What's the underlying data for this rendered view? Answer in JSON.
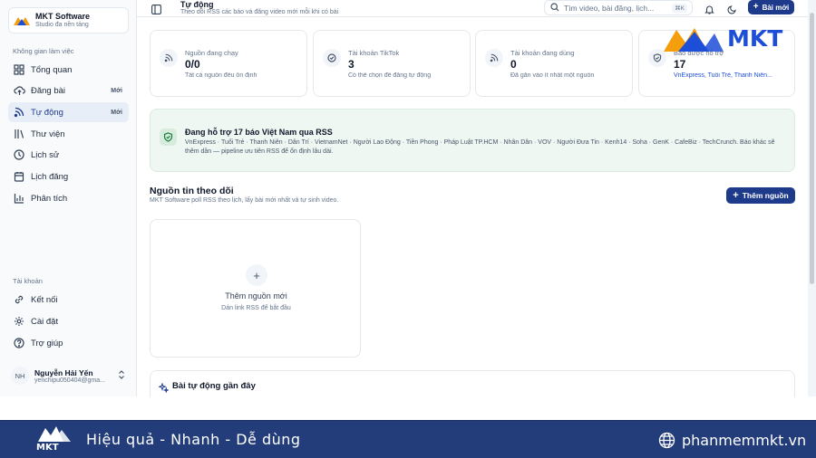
{
  "brand": {
    "name": "MKT Software",
    "subtitle": "Studio đa nền tảng"
  },
  "sidebar": {
    "workspace_label": "Không gian làm việc",
    "items": [
      {
        "label": "Tổng quan",
        "icon": "grid-icon",
        "badge": ""
      },
      {
        "label": "Đăng bài",
        "icon": "cloud-upload-icon",
        "badge": "Mới"
      },
      {
        "label": "Tự động",
        "icon": "rss-icon",
        "badge": "Mới",
        "active": true
      },
      {
        "label": "Thư viện",
        "icon": "library-icon",
        "badge": ""
      },
      {
        "label": "Lịch sử",
        "icon": "clock-icon",
        "badge": ""
      },
      {
        "label": "Lịch đăng",
        "icon": "calendar-icon",
        "badge": ""
      },
      {
        "label": "Phân tích",
        "icon": "bar-chart-icon",
        "badge": ""
      }
    ],
    "account_label": "Tài khoản",
    "account_items": [
      {
        "label": "Kết nối",
        "icon": "link-icon"
      },
      {
        "label": "Cài đặt",
        "icon": "gear-icon"
      },
      {
        "label": "Trợ giúp",
        "icon": "help-icon"
      }
    ],
    "user": {
      "initials": "NH",
      "name": "Nguyễn Hải Yến",
      "email": "yenchipu050404@gma..."
    }
  },
  "header": {
    "title": "Tự động",
    "subtitle": "Theo dõi RSS các báo và đăng video mới mỗi khi có bài",
    "search_placeholder": "Tìm video, bài đăng, lịch...",
    "search_shortcut": "⌘K",
    "new_post_label": "Bài mới"
  },
  "stats": [
    {
      "label": "Nguồn đang chạy",
      "value": "0/0",
      "desc": "Tất cả nguồn đều ổn định",
      "icon": "rss-icon"
    },
    {
      "label": "Tài khoản TikTok",
      "value": "3",
      "desc": "Có thể chọn để đăng tự động",
      "icon": "check-circle-icon"
    },
    {
      "label": "Tài khoản đang dùng",
      "value": "0",
      "desc": "Đã gắn vào ít nhất một nguồn",
      "icon": "rss-icon"
    },
    {
      "label": "Báo được hỗ trợ",
      "value": "17",
      "desc": "VnExpress, Tuổi Trẻ, Thanh Niên...",
      "icon": "shield-check-icon"
    }
  ],
  "rss_info": {
    "title": "Đang hỗ trợ 17 báo Việt Nam qua RSS",
    "text": "VnExpress · Tuổi Trẻ · Thanh Niên · Dân Trí · VietnamNet · Người Lao Động · Tiền Phong · Pháp Luật TP.HCM · Nhân Dân · VOV · Người Đưa Tin · Kenh14 · Soha · GenK · CafeBiz · TechCrunch. Báo khác sẽ thêm dần — pipeline ưu tiên RSS để ổn định lâu dài."
  },
  "sources": {
    "title": "Nguồn tin theo dõi",
    "subtitle": "MKT Software poll RSS theo lịch, lấy bài mới nhất và tự sinh video.",
    "add_button": "Thêm nguồn",
    "empty_title": "Thêm nguồn mới",
    "empty_sub": "Dán link RSS để bắt đầu"
  },
  "recent": {
    "title": "Bài tự động gần đây"
  },
  "watermark": {
    "text": "MKT"
  },
  "footer": {
    "logo_text": "MKT",
    "slogan": "Hiệu quả - Nhanh - Dễ dùng",
    "site": "phanmemmkt.vn"
  },
  "colors": {
    "primary": "#1e3a8a",
    "footer": "#233c7a",
    "success_bg": "#eef7f1",
    "watermark": "#1d4ed8",
    "watermark_orange": "#f59e0b"
  }
}
